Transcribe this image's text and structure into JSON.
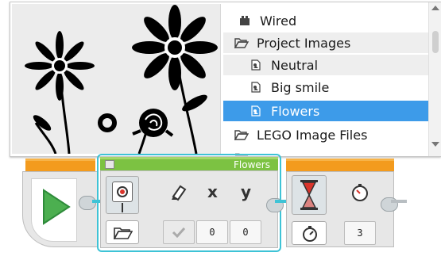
{
  "image_list": {
    "items": [
      {
        "label": "Wired",
        "icon": "brick-icon",
        "indent": 0
      },
      {
        "label": "Project Images",
        "icon": "folder-open-icon",
        "indent": 0
      },
      {
        "label": "Neutral",
        "icon": "image-file-icon",
        "indent": 1
      },
      {
        "label": "Big smile",
        "icon": "image-file-icon",
        "indent": 1
      },
      {
        "label": "Flowers",
        "icon": "image-file-icon",
        "indent": 1,
        "selected": true
      },
      {
        "label": "LEGO Image Files",
        "icon": "folder-open-icon",
        "indent": 0
      }
    ]
  },
  "display_block": {
    "file_name": "Flowers",
    "x_label": "x",
    "y_label": "y",
    "x_value": "0",
    "y_value": "0"
  },
  "wait_block": {
    "seconds_value": "3"
  },
  "colors": {
    "accent_orange": "#f39b1e",
    "accent_green": "#7cc242",
    "selection_blue": "#3d9be9",
    "wire_teal": "#3ec3d6"
  }
}
